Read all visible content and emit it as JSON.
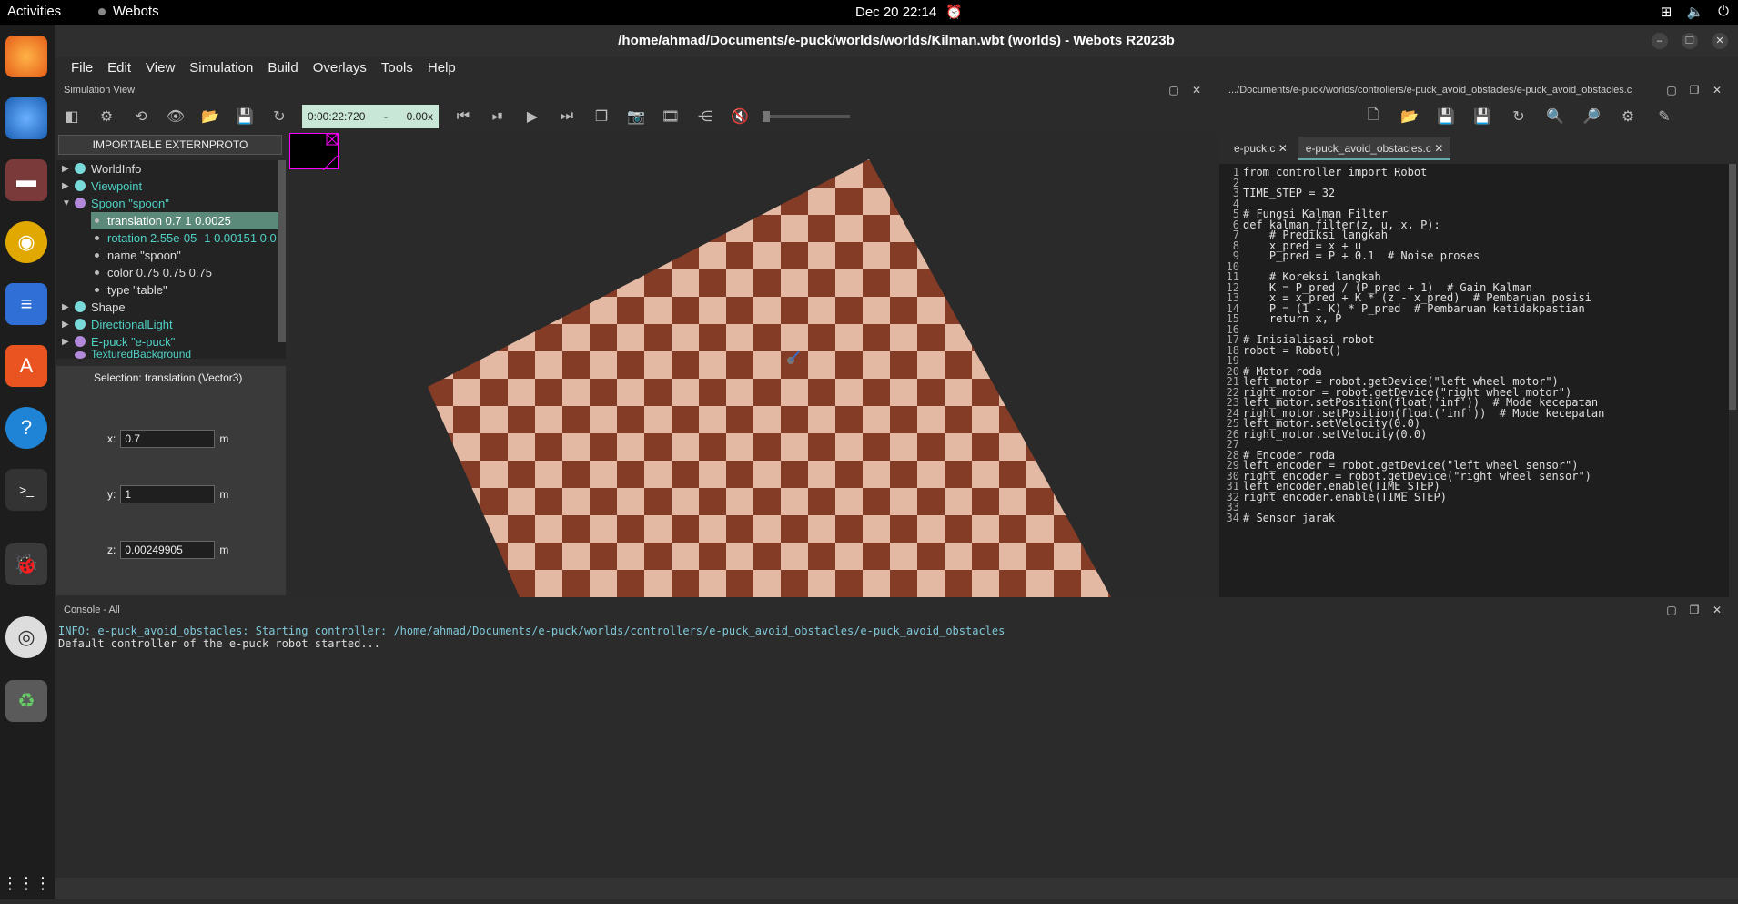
{
  "topbar": {
    "activities": "Activities",
    "app_name": "Webots",
    "clock": "Dec 20  22:14"
  },
  "window": {
    "title": "/home/ahmad/Documents/e-puck/worlds/worlds/Kilman.wbt (worlds) - Webots R2023b"
  },
  "menu": [
    "File",
    "Edit",
    "View",
    "Simulation",
    "Build",
    "Overlays",
    "Tools",
    "Help"
  ],
  "simview": {
    "header": "Simulation View",
    "time": "0:00:22:720",
    "speed_sep": "-",
    "speed": "0.00x"
  },
  "scene_tree": {
    "proto_button": "IMPORTABLE EXTERNPROTO",
    "items": [
      {
        "label": "WorldInfo"
      },
      {
        "label": "Viewpoint"
      },
      {
        "label": "Spoon \"spoon\""
      },
      {
        "label": "translation 0.7 1 0.0025"
      },
      {
        "label": "rotation 2.55e-05 -1 0.00151 0.0"
      },
      {
        "label": "name \"spoon\""
      },
      {
        "label": "color 0.75 0.75 0.75"
      },
      {
        "label": "type \"table\""
      },
      {
        "label": "Shape"
      },
      {
        "label": "DirectionalLight"
      },
      {
        "label": "E-puck \"e-puck\""
      },
      {
        "label": "TexturedBackground"
      }
    ]
  },
  "field_editor": {
    "selection": "Selection: translation (Vector3)",
    "x_label": "x:",
    "x_value": "0.7",
    "y_label": "y:",
    "y_value": "1",
    "z_label": "z:",
    "z_value": "0.00249905",
    "unit": "m"
  },
  "editor": {
    "header": ".../Documents/e-puck/worlds/controllers/e-puck_avoid_obstacles/e-puck_avoid_obstacles.c",
    "tabs": [
      "e-puck.c",
      "e-puck_avoid_obstacles.c"
    ],
    "lines": [
      "from controller import Robot",
      "",
      "TIME_STEP = 32",
      "",
      "# Fungsi Kalman Filter",
      "def kalman_filter(z, u, x, P):",
      "    # Prediksi langkah",
      "    x_pred = x + u",
      "    P_pred = P + 0.1  # Noise proses",
      "",
      "    # Koreksi langkah",
      "    K = P_pred / (P_pred + 1)  # Gain Kalman",
      "    x = x_pred + K * (z - x_pred)  # Pembaruan posisi",
      "    P = (1 - K) * P_pred  # Pembaruan ketidakpastian",
      "    return x, P",
      "",
      "# Inisialisasi robot",
      "robot = Robot()",
      "",
      "# Motor roda",
      "left_motor = robot.getDevice(\"left wheel motor\")",
      "right_motor = robot.getDevice(\"right wheel motor\")",
      "left_motor.setPosition(float('inf'))  # Mode kecepatan",
      "right_motor.setPosition(float('inf'))  # Mode kecepatan",
      "left_motor.setVelocity(0.0)",
      "right_motor.setVelocity(0.0)",
      "",
      "# Encoder roda",
      "left_encoder = robot.getDevice(\"left wheel sensor\")",
      "right_encoder = robot.getDevice(\"right wheel sensor\")",
      "left_encoder.enable(TIME_STEP)",
      "right_encoder.enable(TIME_STEP)",
      "",
      "# Sensor jarak"
    ]
  },
  "console": {
    "header": "Console - All",
    "line1": "INFO: e-puck_avoid_obstacles: Starting controller: /home/ahmad/Documents/e-puck/worlds/controllers/e-puck_avoid_obstacles/e-puck_avoid_obstacles",
    "line2": "Default controller of the e-puck robot started..."
  },
  "colors": {
    "node_ball": "#7ad9d9",
    "teal_text": "#4fd1c5",
    "selected_row": "#5c8a7a",
    "time_bg": "#c9e7d6",
    "floor_light": "#e8b8a0",
    "floor_dark": "#8b3a22"
  }
}
